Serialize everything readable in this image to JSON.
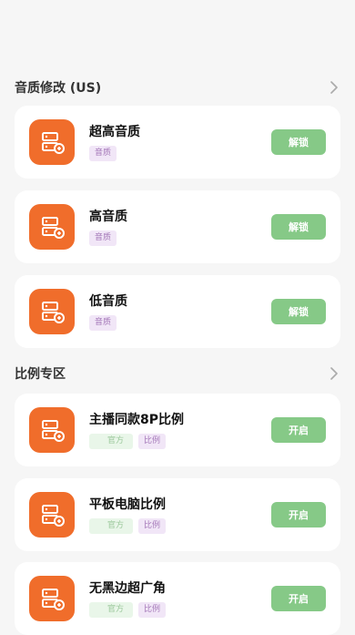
{
  "sections": [
    {
      "title": "音质修改 (US)",
      "items": [
        {
          "title": "超高音质",
          "tags": [
            {
              "label": "音质",
              "color": "purple"
            }
          ],
          "action": "解锁"
        },
        {
          "title": "高音质",
          "tags": [
            {
              "label": "音质",
              "color": "purple"
            }
          ],
          "action": "解锁"
        },
        {
          "title": "低音质",
          "tags": [
            {
              "label": "音质",
              "color": "purple"
            }
          ],
          "action": "解锁"
        }
      ]
    },
    {
      "title": "比例专区",
      "items": [
        {
          "title": "主播同款8P比例",
          "tags": [
            {
              "label": "官方",
              "color": "green"
            },
            {
              "label": "比例",
              "color": "purple"
            }
          ],
          "action": "开启"
        },
        {
          "title": "平板电脑比例",
          "tags": [
            {
              "label": "官方",
              "color": "green"
            },
            {
              "label": "比例",
              "color": "purple"
            }
          ],
          "action": "开启"
        },
        {
          "title": "无黑边超广角",
          "tags": [
            {
              "label": "官方",
              "color": "green"
            },
            {
              "label": "比例",
              "color": "purple"
            }
          ],
          "action": "开启"
        }
      ]
    }
  ],
  "colors": {
    "accent_orange": "#f06d2b",
    "button_green": "#86c987",
    "background": "#f6f6f6"
  },
  "icons": {
    "app": "server-icon",
    "more": "chevron-right-icon"
  }
}
